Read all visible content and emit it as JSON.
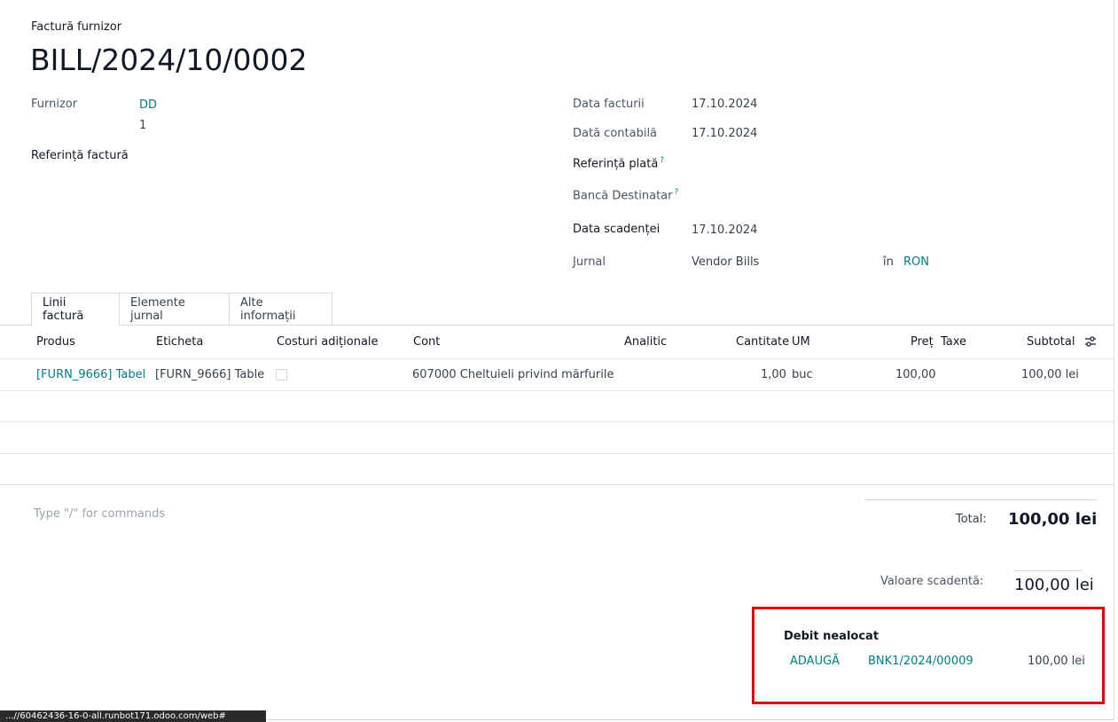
{
  "header": {
    "doc_type": "Factură furnizor",
    "doc_number": "BILL/2024/10/0002"
  },
  "left_fields": {
    "vendor_label": "Furnizor",
    "vendor_value": "DD",
    "vendor_sub": "1",
    "bill_ref_label": "Referință factură"
  },
  "right_fields": {
    "invoice_date_label": "Data facturii",
    "invoice_date_value": "17.10.2024",
    "accounting_date_label": "Dată contabilă",
    "accounting_date_value": "17.10.2024",
    "payment_ref_label": "Referință plată",
    "bank_label": "Bancă Destinatar",
    "due_date_label": "Data scadenței",
    "due_date_value": "17.10.2024",
    "journal_label": "Jurnal",
    "journal_value": "Vendor Bills",
    "currency_in": "în",
    "currency_value": "RON",
    "help_mark": "?"
  },
  "tabs": [
    {
      "label": "Linii factură"
    },
    {
      "label": "Elemente jurnal"
    },
    {
      "label": "Alte informații"
    }
  ],
  "table": {
    "headers": {
      "product": "Produs",
      "label": "Eticheta",
      "extra_costs": "Costuri adiționale",
      "account": "Cont",
      "analytic": "Analitic",
      "quantity": "Cantitate",
      "uom": "UM",
      "price": "Preț",
      "taxes": "Taxe",
      "subtotal": "Subtotal"
    },
    "rows": [
      {
        "product": "[FURN_9666] Tabel",
        "label": "[FURN_9666] Table",
        "account": "607000 Cheltuieli privind mărfurile",
        "quantity": "1,00",
        "uom": "buc",
        "price": "100,00",
        "subtotal": "100,00 lei"
      }
    ]
  },
  "notes": {
    "placeholder": "Type \"/\" for commands"
  },
  "totals": {
    "total_label": "Total:",
    "total_value": "100,00 lei",
    "amount_due_label": "Valoare scadentă:",
    "amount_due_value": "100,00 lei"
  },
  "outstanding": {
    "title": "Debit nealocat",
    "add_label": "ADAUGĂ",
    "payment_ref": "BNK1/2024/00009",
    "amount": "100,00 lei"
  },
  "status_bar": {
    "text": "...//60462436-16-0-all.runbot171.odoo.com/web#"
  },
  "colors": {
    "link": "#017e84",
    "highlight_border": "#e00000"
  }
}
